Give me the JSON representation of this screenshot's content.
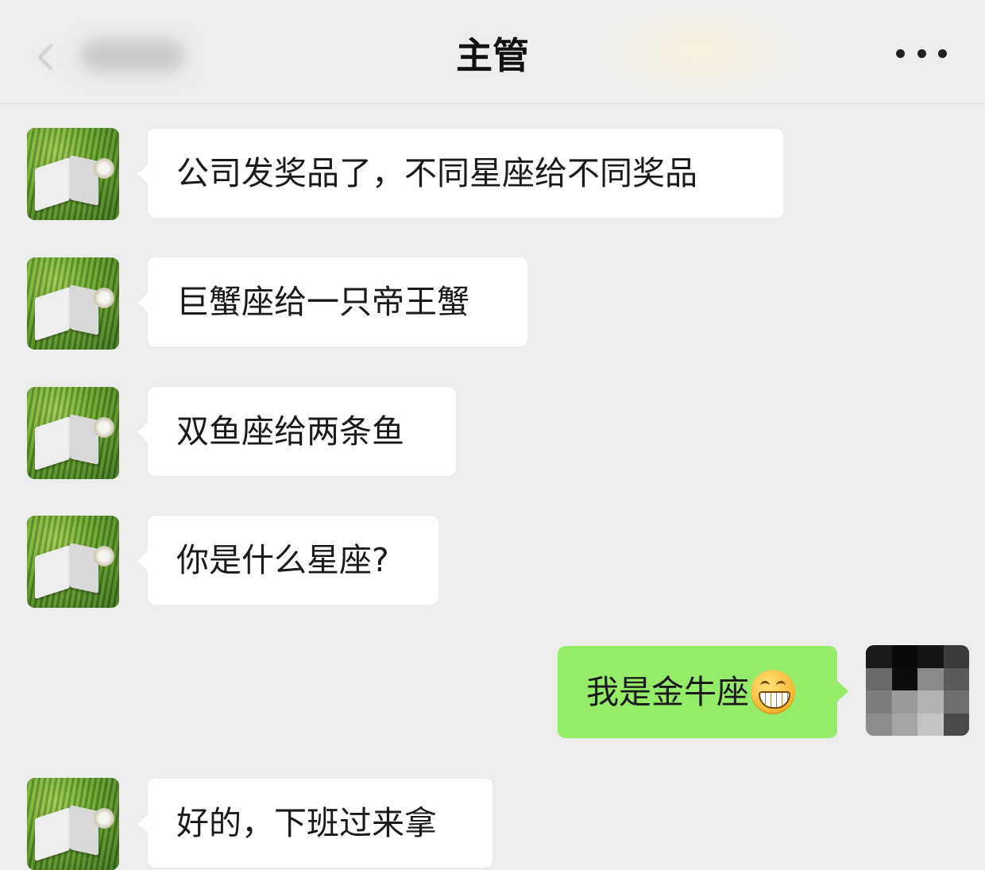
{
  "header": {
    "title": "主管"
  },
  "messages": [
    {
      "side": "left",
      "text": "公司发奖品了，不同星座给不同奖品"
    },
    {
      "side": "left",
      "text": "巨蟹座给一只帝王蟹"
    },
    {
      "side": "left",
      "text": "双鱼座给两条鱼"
    },
    {
      "side": "left",
      "text": "你是什么星座?"
    },
    {
      "side": "right",
      "text": "我是金牛座",
      "emoji": "grinning-face-emoji"
    },
    {
      "side": "left",
      "text": "好的，下班过来拿"
    }
  ],
  "icons": {
    "back": "chevron-left-icon",
    "more": "more-dots-icon"
  },
  "colors": {
    "background": "#ededed",
    "incoming_bubble": "#ffffff",
    "outgoing_bubble": "#95ec69"
  }
}
